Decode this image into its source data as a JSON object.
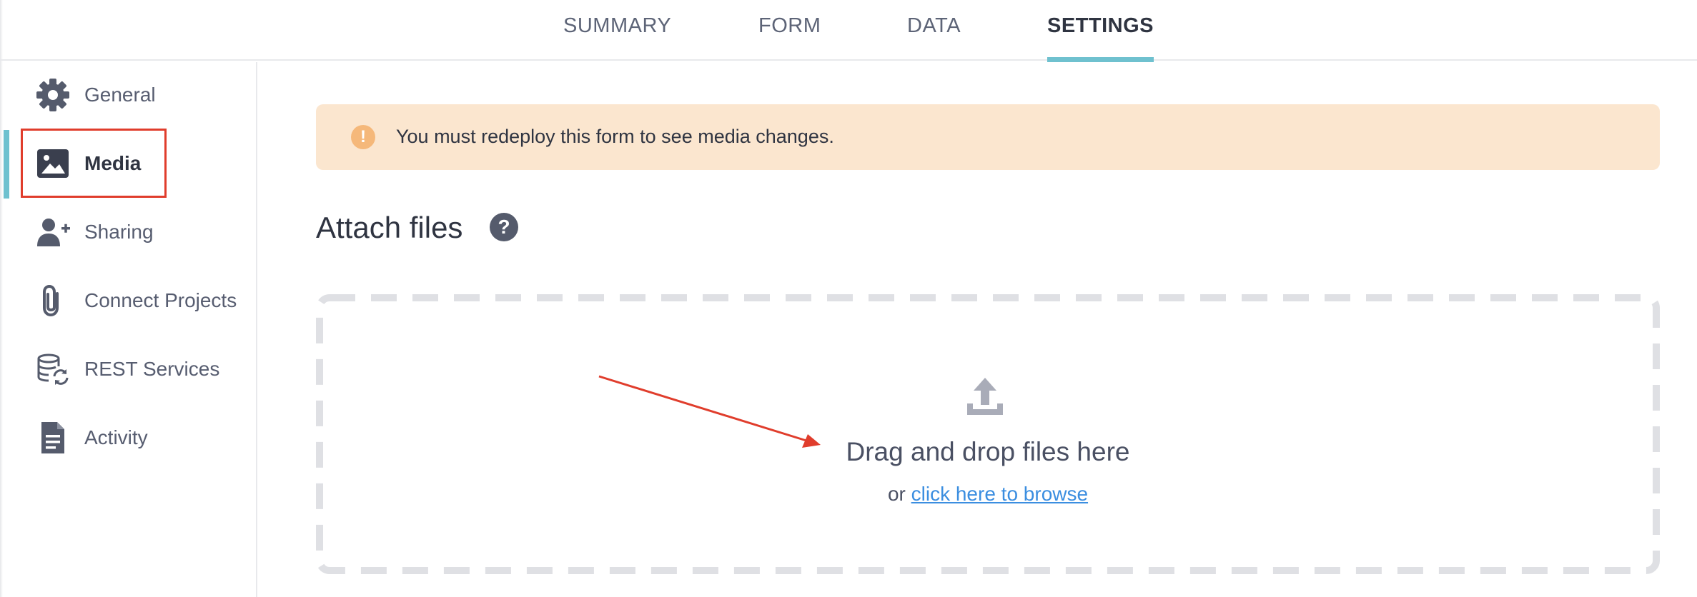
{
  "tabs": [
    {
      "label": "SUMMARY",
      "active": false
    },
    {
      "label": "FORM",
      "active": false
    },
    {
      "label": "DATA",
      "active": false
    },
    {
      "label": "SETTINGS",
      "active": true
    }
  ],
  "sidebar": {
    "items": [
      {
        "label": "General",
        "icon": "gear-icon",
        "active": false
      },
      {
        "label": "Media",
        "icon": "image-icon",
        "active": true
      },
      {
        "label": "Sharing",
        "icon": "user-plus-icon",
        "active": false
      },
      {
        "label": "Connect Projects",
        "icon": "paperclip-icon",
        "active": false
      },
      {
        "label": "REST Services",
        "icon": "database-sync-icon",
        "active": false
      },
      {
        "label": "Activity",
        "icon": "document-icon",
        "active": false
      }
    ]
  },
  "alert": {
    "icon": "exclamation-icon",
    "text": "You must redeploy this form to see media changes."
  },
  "attach": {
    "title": "Attach files",
    "help_symbol": "?",
    "drop_text": "Drag and drop files here",
    "browse_prefix": "or",
    "browse_link": "click here to browse"
  },
  "colors": {
    "accent": "#6fc1cf",
    "alert_bg": "#fbe6cf",
    "alert_icon": "#f5b87a",
    "link": "#3b8ee0",
    "annotation": "#e03d2c",
    "icon": "#555b6c"
  }
}
